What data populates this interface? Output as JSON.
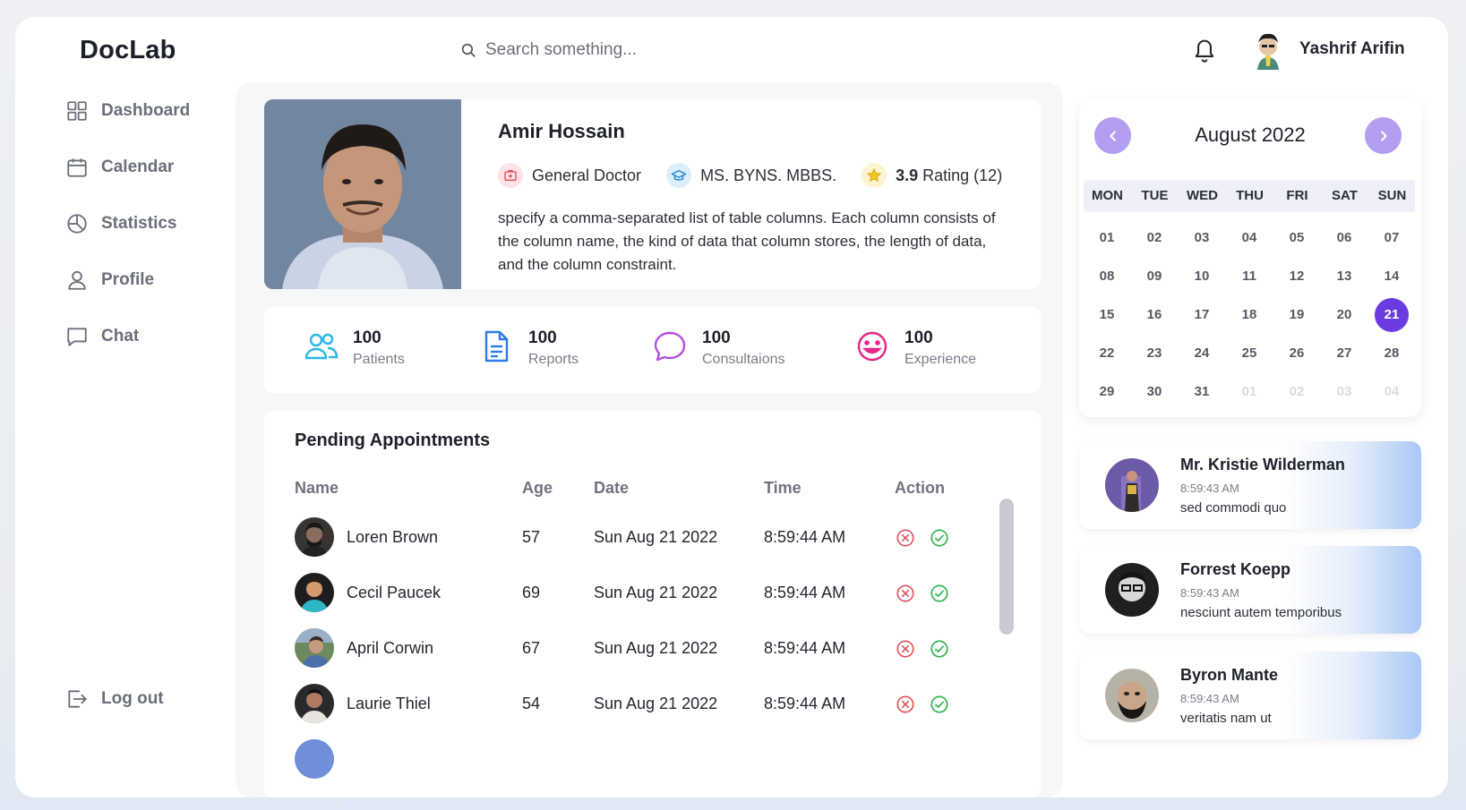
{
  "brand": "DocLab",
  "search": {
    "placeholder": "Search something..."
  },
  "user": {
    "name": "Yashrif Arifin"
  },
  "nav": {
    "items": [
      {
        "label": "Dashboard",
        "icon": "grid-icon"
      },
      {
        "label": "Calendar",
        "icon": "calendar-icon"
      },
      {
        "label": "Statistics",
        "icon": "pie-chart-icon"
      },
      {
        "label": "Profile",
        "icon": "user-icon"
      },
      {
        "label": "Chat",
        "icon": "chat-bubble-icon"
      }
    ],
    "logout": "Log out"
  },
  "doctor": {
    "name": "Amir Hossain",
    "specialty": "General Doctor",
    "degree": "MS. BYNS. MBBS.",
    "rating": "3.9",
    "rating_label": "Rating (12)",
    "description": "specify a comma-separated list of table columns. Each column consists of the column name, the kind of data that column stores, the length of data, and the column constraint."
  },
  "stats": [
    {
      "value": "100",
      "label": "Patients",
      "color": "#29b6e8"
    },
    {
      "value": "100",
      "label": "Reports",
      "color": "#2d7be6"
    },
    {
      "value": "100",
      "label": "Consultaions",
      "color": "#b24fe0"
    },
    {
      "value": "100",
      "label": "Experience",
      "color": "#e6268a"
    }
  ],
  "appointments": {
    "title": "Pending Appointments",
    "columns": [
      "Name",
      "Age",
      "Date",
      "Time",
      "Action"
    ],
    "rows": [
      {
        "name": "Loren Brown",
        "age": "57",
        "date": "Sun Aug 21 2022",
        "time": "8:59:44 AM"
      },
      {
        "name": "Cecil Paucek",
        "age": "69",
        "date": "Sun Aug 21 2022",
        "time": "8:59:44 AM"
      },
      {
        "name": "April Corwin",
        "age": "67",
        "date": "Sun Aug 21 2022",
        "time": "8:59:44 AM"
      },
      {
        "name": "Laurie Thiel",
        "age": "54",
        "date": "Sun Aug 21 2022",
        "time": "8:59:44 AM"
      }
    ]
  },
  "calendar": {
    "title": "August 2022",
    "weekdays": [
      "MON",
      "TUE",
      "WED",
      "THU",
      "FRI",
      "SAT",
      "SUN"
    ],
    "days": [
      "01",
      "02",
      "03",
      "04",
      "05",
      "06",
      "07",
      "08",
      "09",
      "10",
      "11",
      "12",
      "13",
      "14",
      "15",
      "16",
      "17",
      "18",
      "19",
      "20",
      "21",
      "22",
      "23",
      "24",
      "25",
      "26",
      "27",
      "28",
      "29",
      "30",
      "31",
      "01",
      "02",
      "03",
      "04"
    ],
    "selected": "21",
    "accent": "#6a3be0"
  },
  "messages": [
    {
      "name": "Mr. Kristie Wilderman",
      "time": "8:59:43 AM",
      "text": "sed commodi quo"
    },
    {
      "name": "Forrest Koepp",
      "time": "8:59:43 AM",
      "text": "nesciunt autem temporibus"
    },
    {
      "name": "Byron Mante",
      "time": "8:59:43 AM",
      "text": "veritatis nam ut"
    }
  ]
}
